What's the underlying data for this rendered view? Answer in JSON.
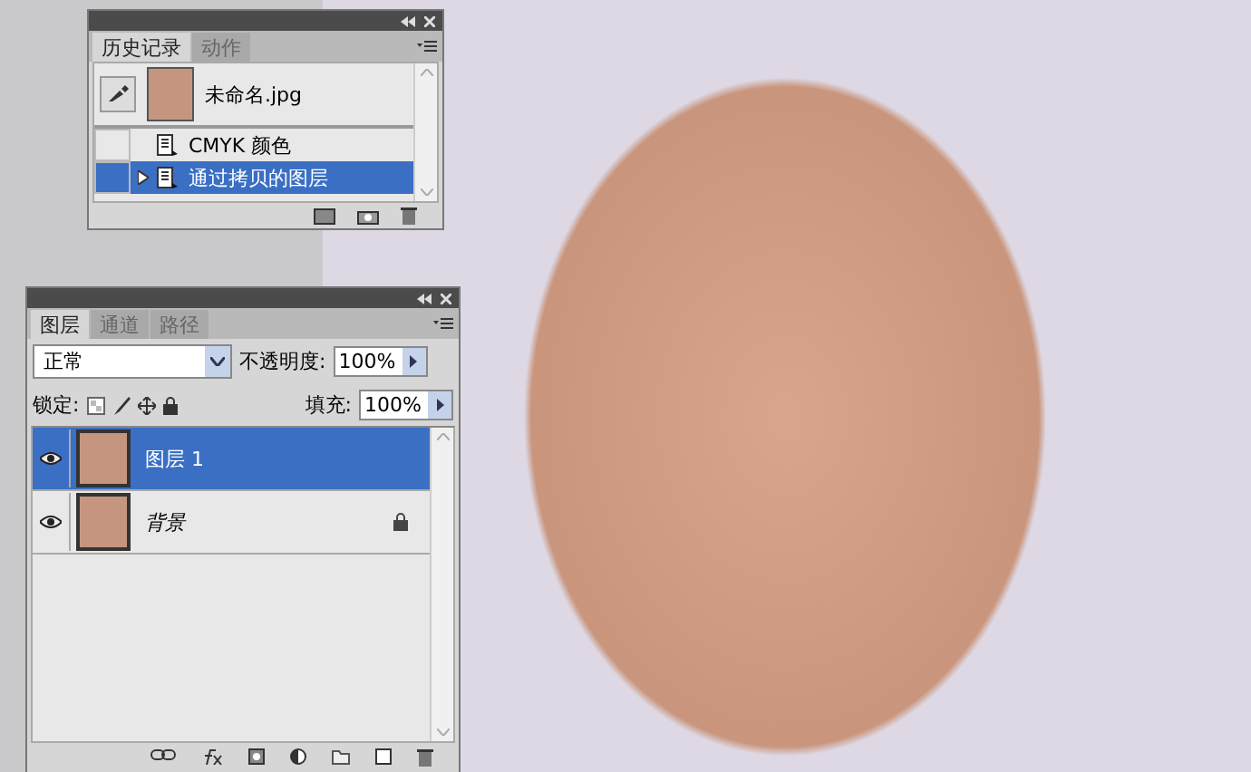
{
  "history_panel": {
    "tabs": [
      {
        "label": "历史记录",
        "selected": true
      },
      {
        "label": "动作",
        "selected": false
      }
    ],
    "snapshot": {
      "name": "未命名.jpg"
    },
    "states": [
      {
        "label": "CMYK 颜色",
        "selected": false
      },
      {
        "label": "通过拷贝的图层",
        "selected": true
      }
    ]
  },
  "layers_panel": {
    "tabs": [
      {
        "label": "图层",
        "selected": true
      },
      {
        "label": "通道",
        "selected": false
      },
      {
        "label": "路径",
        "selected": false
      }
    ],
    "blend_mode": "正常",
    "opacity_label": "不透明度:",
    "opacity": "100%",
    "lock_label": "锁定:",
    "fill_label": "填充:",
    "fill": "100%",
    "layers": [
      {
        "name": "图层 1",
        "selected": true,
        "visible": true,
        "locked": false
      },
      {
        "name": "背景",
        "selected": false,
        "visible": true,
        "locked": true
      }
    ]
  }
}
